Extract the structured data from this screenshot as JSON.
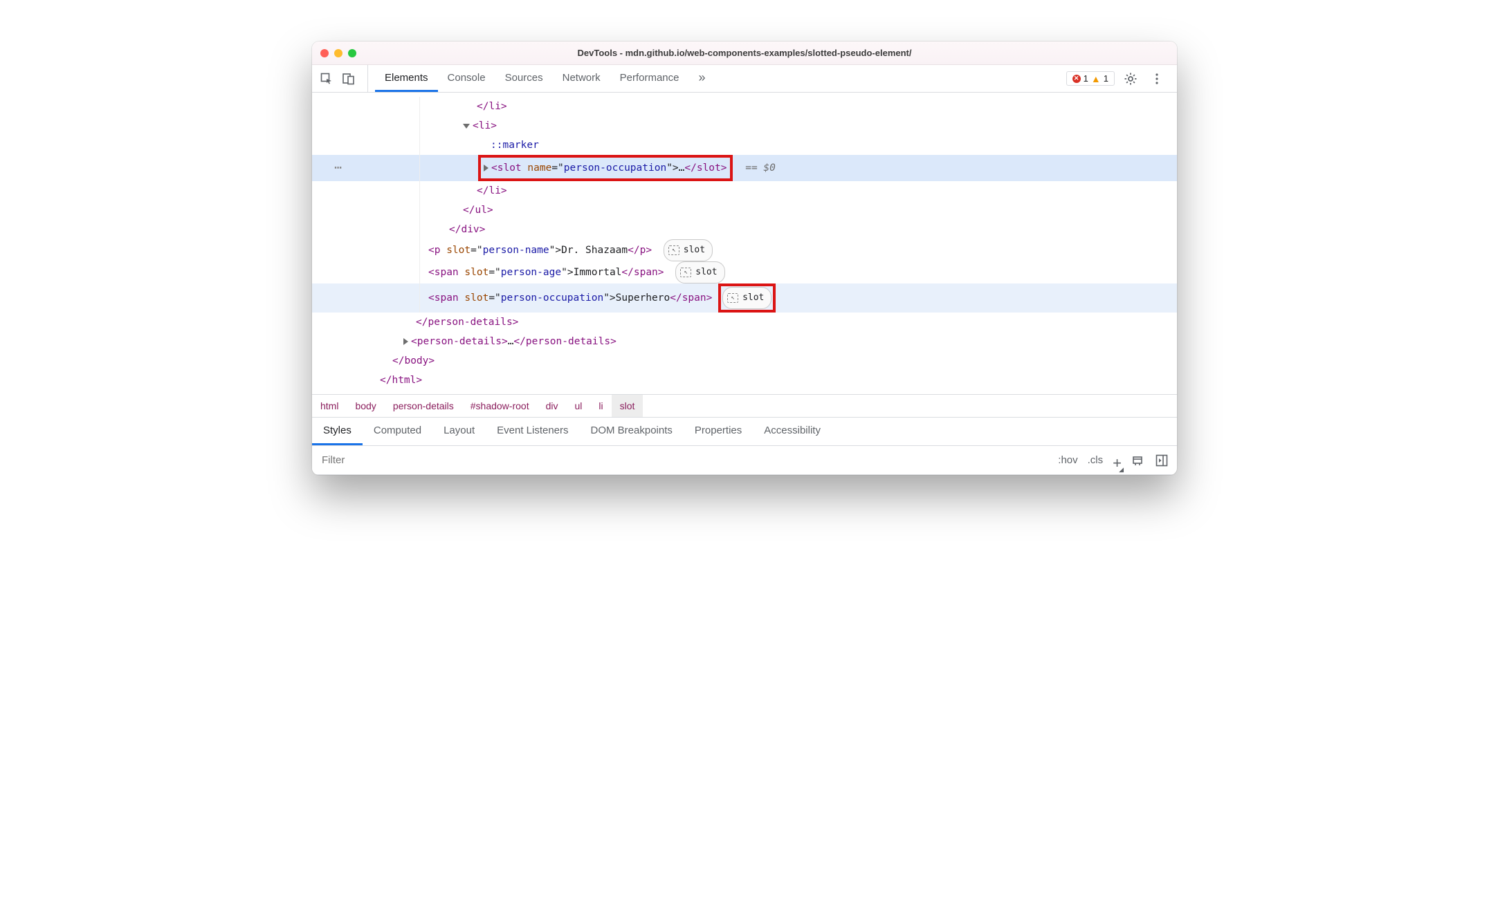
{
  "title": "DevTools - mdn.github.io/web-components-examples/slotted-pseudo-element/",
  "toolbar": {
    "tabs": [
      "Elements",
      "Console",
      "Sources",
      "Network",
      "Performance"
    ],
    "more_glyph": "»",
    "errors": "1",
    "warnings": "1"
  },
  "dom": {
    "li_close": "</li>",
    "li_open": "<li>",
    "marker": "::marker",
    "slot_open_a": "<slot",
    "slot_attr_name": " name",
    "slot_attr_eq": "=\"",
    "slot_attr_val": "person-occupation",
    "slot_attr_close": "\">",
    "slot_ellipsis": "…",
    "slot_close": "</slot>",
    "eqref": "== $0",
    "li_close2": "</li>",
    "ul_close": "</ul>",
    "div_close": "</div>",
    "p_line_open": "<p",
    "p_slot_attr": " slot",
    "p_slot_val": "person-name",
    "p_text": "Dr. Shazaam",
    "p_close": "</p>",
    "span1_open": "<span",
    "span1_slot_val": "person-age",
    "span1_text": "Immortal",
    "span_close": "</span>",
    "span2_slot_val": "person-occupation",
    "span2_text": "Superhero",
    "pd_close": "</person-details>",
    "pd2_open": "<person-details>",
    "pd2_ell": "…",
    "pd2_close": "</person-details>",
    "body_close": "</body>",
    "html_close": "</html>",
    "slot_badge": "slot",
    "gutter_dots": "⋯"
  },
  "breadcrumb": [
    "html",
    "body",
    "person-details",
    "#shadow-root",
    "div",
    "ul",
    "li",
    "slot"
  ],
  "styles_tabs": [
    "Styles",
    "Computed",
    "Layout",
    "Event Listeners",
    "DOM Breakpoints",
    "Properties",
    "Accessibility"
  ],
  "filter": {
    "placeholder": "Filter",
    "hov": ":hov",
    "cls": ".cls"
  }
}
